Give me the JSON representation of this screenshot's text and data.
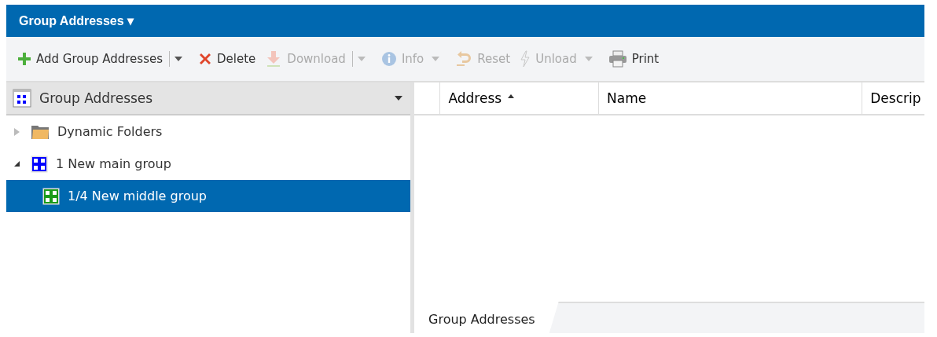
{
  "title_bar": {
    "title": "Group Addresses",
    "caret": "▾"
  },
  "toolbar": [
    {
      "kind": "add",
      "label": "Add Group Addresses",
      "disabled": false,
      "split": true
    },
    {
      "kind": "delete",
      "label": "Delete",
      "disabled": false,
      "split": false
    },
    {
      "kind": "download",
      "label": "Download",
      "disabled": true,
      "split": true
    },
    {
      "kind": "info",
      "label": "Info",
      "disabled": true,
      "menu": true
    },
    {
      "kind": "reset",
      "label": "Reset",
      "disabled": true
    },
    {
      "kind": "unload",
      "label": "Unload",
      "disabled": true,
      "menu": true
    },
    {
      "kind": "print",
      "label": "Print",
      "disabled": false
    }
  ],
  "tree_panel": {
    "title": "Group Addresses",
    "items": [
      {
        "kind": "folder",
        "label": "Dynamic Folders",
        "expanded": false,
        "selected": false
      },
      {
        "kind": "main",
        "label": "1 New main group",
        "expanded": true,
        "selected": false,
        "children": [
          {
            "kind": "middle",
            "label": "1/4 New middle group",
            "selected": true
          }
        ]
      }
    ]
  },
  "table": {
    "columns": [
      {
        "label": "Address",
        "sorted": true
      },
      {
        "label": "Name",
        "sorted": false
      },
      {
        "label": "Descrip",
        "sorted": false
      }
    ]
  },
  "bottom_tabs": [
    {
      "label": "Group Addresses",
      "selected": true
    }
  ]
}
